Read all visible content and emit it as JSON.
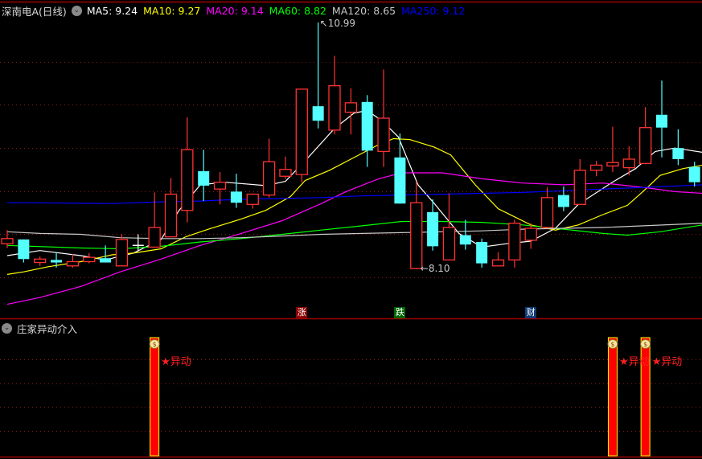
{
  "header": {
    "title": "深南电A(日线)",
    "toggle_icon": "chevron-down-icon",
    "ma_labels": [
      {
        "text": "MA5: 9.24",
        "color": "#ffffff"
      },
      {
        "text": "MA10: 9.27",
        "color": "#ffff00"
      },
      {
        "text": "MA20: 9.14",
        "color": "#ff00ff"
      },
      {
        "text": "MA60: 8.82",
        "color": "#00ff00"
      },
      {
        "text": "MA120: 8.65",
        "color": "#c8c8c8"
      },
      {
        "text": "MA250: 9.12",
        "color": "#0000ff"
      }
    ]
  },
  "indicator_panel": {
    "title": "庄家异动介入",
    "annotation": "★异动",
    "icon": "money-bag-icon"
  },
  "chart_data": [
    {
      "type": "candlestick",
      "title": "深南电A(日线)",
      "ylim": [
        7.7,
        11.0
      ],
      "grid_levels": [
        10.53,
        10.03,
        9.52,
        9.01,
        8.51,
        8.01
      ],
      "high_label": {
        "index": 19,
        "text": "10.99"
      },
      "low_label": {
        "index": 25,
        "text": "8.10"
      },
      "colors": {
        "up": "#ff3232",
        "down": "#54ffff",
        "flat": "#ffffff"
      },
      "candles": [
        [
          8.4,
          8.56,
          8.35,
          8.46
        ],
        [
          8.45,
          8.45,
          8.18,
          8.22
        ],
        [
          8.18,
          8.25,
          8.14,
          8.22
        ],
        [
          8.21,
          8.3,
          8.12,
          8.18
        ],
        [
          8.14,
          8.28,
          8.12,
          8.19
        ],
        [
          8.19,
          8.29,
          8.17,
          8.24
        ],
        [
          8.23,
          8.38,
          8.18,
          8.18
        ],
        [
          8.14,
          8.51,
          8.14,
          8.45
        ],
        [
          8.38,
          8.51,
          8.32,
          8.38
        ],
        [
          8.36,
          9.0,
          8.36,
          8.59
        ],
        [
          8.48,
          9.17,
          8.48,
          8.98
        ],
        [
          8.79,
          9.88,
          8.65,
          9.5
        ],
        [
          9.25,
          9.5,
          8.9,
          9.08
        ],
        [
          9.04,
          9.24,
          8.86,
          9.12
        ],
        [
          9.01,
          9.22,
          8.82,
          8.88
        ],
        [
          8.86,
          8.99,
          8.81,
          8.98
        ],
        [
          8.97,
          9.63,
          8.94,
          9.36
        ],
        [
          9.19,
          9.42,
          9.16,
          9.27
        ],
        [
          9.21,
          10.21,
          9.12,
          10.21
        ],
        [
          10.01,
          10.99,
          9.75,
          9.84
        ],
        [
          9.73,
          10.6,
          9.68,
          10.25
        ],
        [
          9.94,
          10.22,
          9.68,
          10.05
        ],
        [
          10.06,
          10.14,
          9.3,
          9.49
        ],
        [
          9.48,
          10.44,
          9.3,
          9.87
        ],
        [
          9.41,
          9.69,
          8.87,
          8.87
        ],
        [
          8.11,
          9.13,
          8.1,
          8.88
        ],
        [
          8.77,
          8.92,
          8.32,
          8.37
        ],
        [
          8.21,
          8.99,
          8.21,
          8.59
        ],
        [
          8.5,
          8.68,
          8.33,
          8.39
        ],
        [
          8.42,
          8.46,
          8.12,
          8.17
        ],
        [
          8.14,
          8.3,
          8.14,
          8.21
        ],
        [
          8.21,
          8.68,
          8.12,
          8.64
        ],
        [
          8.44,
          8.64,
          8.34,
          8.58
        ],
        [
          8.59,
          9.06,
          8.59,
          8.94
        ],
        [
          8.97,
          9.07,
          8.78,
          8.83
        ],
        [
          8.86,
          9.39,
          8.86,
          9.26
        ],
        [
          9.26,
          9.37,
          9.19,
          9.32
        ],
        [
          9.31,
          9.77,
          9.24,
          9.35
        ],
        [
          9.29,
          9.54,
          9.2,
          9.39
        ],
        [
          9.34,
          10.0,
          9.33,
          9.76
        ],
        [
          9.91,
          10.31,
          9.41,
          9.76
        ],
        [
          9.52,
          9.74,
          9.32,
          9.39
        ],
        [
          9.3,
          9.36,
          9.07,
          9.12
        ]
      ],
      "series": [
        {
          "name": "MA5",
          "color": "#ffffff",
          "points": [
            [
              0,
              8.26
            ],
            [
              2,
              8.32
            ],
            [
              4.5,
              8.26
            ],
            [
              6,
              8.21
            ],
            [
              7.7,
              8.29
            ],
            [
              9.4,
              8.45
            ],
            [
              10.5,
              8.79
            ],
            [
              11.8,
              9.09
            ],
            [
              13.3,
              9.12
            ],
            [
              15.8,
              9.08
            ],
            [
              17,
              9.13
            ],
            [
              18.2,
              9.37
            ],
            [
              20,
              9.75
            ],
            [
              21.2,
              9.93
            ],
            [
              22,
              9.96
            ],
            [
              22.9,
              9.84
            ],
            [
              23.9,
              9.65
            ],
            [
              25.1,
              9.09
            ],
            [
              26.1,
              8.87
            ],
            [
              27.6,
              8.52
            ],
            [
              29,
              8.36
            ],
            [
              30.5,
              8.4
            ],
            [
              32,
              8.43
            ],
            [
              33.5,
              8.58
            ],
            [
              34.9,
              8.86
            ],
            [
              36.9,
              9.11
            ],
            [
              38.4,
              9.28
            ],
            [
              39.6,
              9.48
            ],
            [
              40.8,
              9.52
            ],
            [
              42.5,
              9.47
            ]
          ]
        },
        {
          "name": "MA10",
          "color": "#ffff00",
          "points": [
            [
              0,
              8.04
            ],
            [
              1,
              8.07
            ],
            [
              2.5,
              8.13
            ],
            [
              4.5,
              8.19
            ],
            [
              6.4,
              8.27
            ],
            [
              7.7,
              8.29
            ],
            [
              9.4,
              8.34
            ],
            [
              10.9,
              8.48
            ],
            [
              12.3,
              8.57
            ],
            [
              14.3,
              8.69
            ],
            [
              15.8,
              8.79
            ],
            [
              17.3,
              8.95
            ],
            [
              18.2,
              9.14
            ],
            [
              19.7,
              9.26
            ],
            [
              21.2,
              9.41
            ],
            [
              22.7,
              9.56
            ],
            [
              23.6,
              9.63
            ],
            [
              24.6,
              9.62
            ],
            [
              26.1,
              9.53
            ],
            [
              27.1,
              9.44
            ],
            [
              28.6,
              9.09
            ],
            [
              30,
              8.81
            ],
            [
              32,
              8.62
            ],
            [
              33.5,
              8.56
            ],
            [
              34.9,
              8.62
            ],
            [
              36.4,
              8.74
            ],
            [
              37.9,
              8.85
            ],
            [
              38.9,
              9.02
            ],
            [
              39.9,
              9.2
            ],
            [
              41.3,
              9.28
            ],
            [
              42.5,
              9.32
            ]
          ]
        },
        {
          "name": "MA20",
          "color": "#ff00ff",
          "points": [
            [
              0,
              7.69
            ],
            [
              2,
              7.77
            ],
            [
              4.5,
              7.9
            ],
            [
              6.9,
              8.07
            ],
            [
              9.4,
              8.22
            ],
            [
              11.8,
              8.38
            ],
            [
              14.3,
              8.52
            ],
            [
              16.8,
              8.67
            ],
            [
              19.2,
              8.87
            ],
            [
              20.7,
              9.01
            ],
            [
              22.7,
              9.16
            ],
            [
              24.1,
              9.23
            ],
            [
              26.6,
              9.23
            ],
            [
              29,
              9.16
            ],
            [
              31.5,
              9.11
            ],
            [
              34,
              9.09
            ],
            [
              36.4,
              9.11
            ],
            [
              38.9,
              9.06
            ],
            [
              40.8,
              9.01
            ],
            [
              42.5,
              8.99
            ]
          ]
        },
        {
          "name": "MA60",
          "color": "#00ff00",
          "points": [
            [
              0,
              8.38
            ],
            [
              4.5,
              8.35
            ],
            [
              6.9,
              8.34
            ],
            [
              9.4,
              8.37
            ],
            [
              11.8,
              8.42
            ],
            [
              14.3,
              8.46
            ],
            [
              16.8,
              8.51
            ],
            [
              19.2,
              8.56
            ],
            [
              21.7,
              8.61
            ],
            [
              24.1,
              8.66
            ],
            [
              26.6,
              8.66
            ],
            [
              29,
              8.65
            ],
            [
              31.5,
              8.62
            ],
            [
              34,
              8.57
            ],
            [
              36.4,
              8.52
            ],
            [
              37.9,
              8.5
            ],
            [
              39.9,
              8.54
            ],
            [
              42.5,
              8.62
            ]
          ]
        },
        {
          "name": "MA120",
          "color": "#c8c8c8",
          "points": [
            [
              0,
              8.54
            ],
            [
              2,
              8.52
            ],
            [
              4.5,
              8.51
            ],
            [
              6.9,
              8.47
            ],
            [
              9.4,
              8.46
            ],
            [
              11.8,
              8.46
            ],
            [
              14.3,
              8.47
            ],
            [
              16.8,
              8.49
            ],
            [
              19.2,
              8.51
            ],
            [
              21.7,
              8.52
            ],
            [
              24.1,
              8.53
            ],
            [
              26.6,
              8.54
            ],
            [
              29,
              8.55
            ],
            [
              31.5,
              8.57
            ],
            [
              34,
              8.58
            ],
            [
              36.4,
              8.59
            ],
            [
              38.9,
              8.61
            ],
            [
              42.5,
              8.64
            ]
          ]
        },
        {
          "name": "MA250",
          "color": "#0000ff",
          "points": [
            [
              0,
              8.88
            ],
            [
              1.5,
              8.88
            ],
            [
              6.4,
              8.87
            ],
            [
              9.4,
              8.89
            ],
            [
              11.8,
              8.9
            ],
            [
              14.3,
              8.92
            ],
            [
              16.8,
              8.93
            ],
            [
              19.2,
              8.94
            ],
            [
              21.7,
              8.96
            ],
            [
              24.1,
              8.97
            ],
            [
              26.6,
              8.98
            ],
            [
              29,
              8.99
            ],
            [
              31.5,
              9.0
            ],
            [
              34,
              9.02
            ],
            [
              36.4,
              9.04
            ],
            [
              38.9,
              9.06
            ],
            [
              42.5,
              9.09
            ]
          ]
        }
      ],
      "markers": [
        {
          "index": 18,
          "text": "涨",
          "color": "#8b0000"
        },
        {
          "index": 24,
          "text": "跌",
          "color": "#006400"
        },
        {
          "index": 32,
          "text": "财",
          "color": "#0b3a75"
        }
      ]
    },
    {
      "type": "bar",
      "title": "庄家异动介入",
      "ylim": [
        0,
        1
      ],
      "bars": [
        {
          "index": 9,
          "value": 1,
          "label": "★异动"
        },
        {
          "index": 37,
          "value": 1,
          "label": "★异动"
        },
        {
          "index": 39,
          "value": 1,
          "label": "★异动"
        }
      ]
    }
  ]
}
